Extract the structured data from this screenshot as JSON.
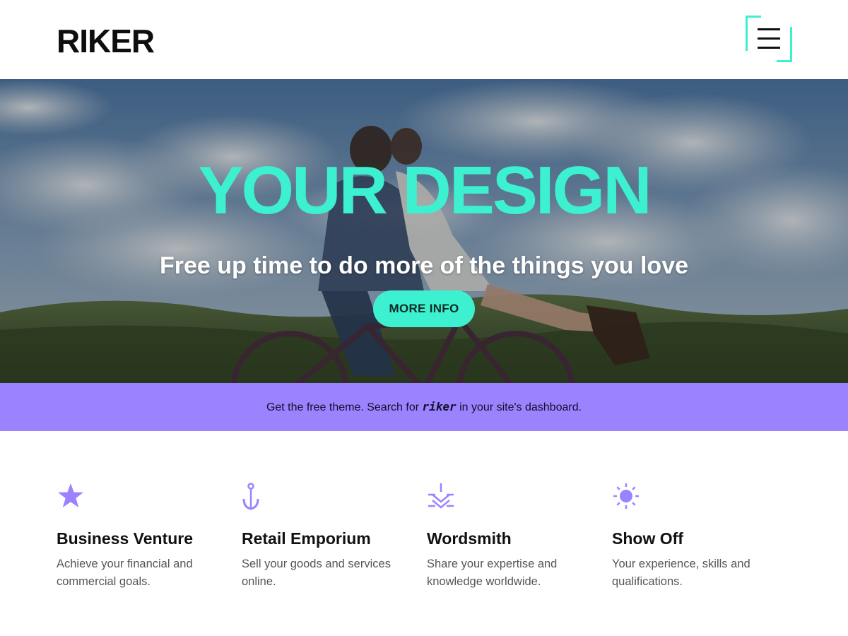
{
  "header": {
    "logo": "RIKER",
    "menu_icon": "hamburger-menu-icon"
  },
  "hero": {
    "title": "YOUR DESIGN",
    "subtitle": "Free up time to do more of the things you love",
    "button_label": "MORE INFO"
  },
  "banner": {
    "prefix": "Get the free theme. Search for ",
    "keyword": "riker",
    "suffix": " in your site's dashboard."
  },
  "features": [
    {
      "icon": "star-icon",
      "title": "Business Venture",
      "text": "Achieve your financial and commercial goals."
    },
    {
      "icon": "anchor-icon",
      "title": "Retail Emporium",
      "text": "Sell your goods and services online."
    },
    {
      "icon": "download-arrow-icon",
      "title": "Wordsmith",
      "text": "Share your expertise and knowledge worldwide."
    },
    {
      "icon": "sun-icon",
      "title": "Show Off",
      "text": "Your experience, skills and qualifications."
    }
  ],
  "colors": {
    "accent": "#3df0cf",
    "purple": "#9b82ff",
    "text": "#111111",
    "muted": "#555555"
  }
}
